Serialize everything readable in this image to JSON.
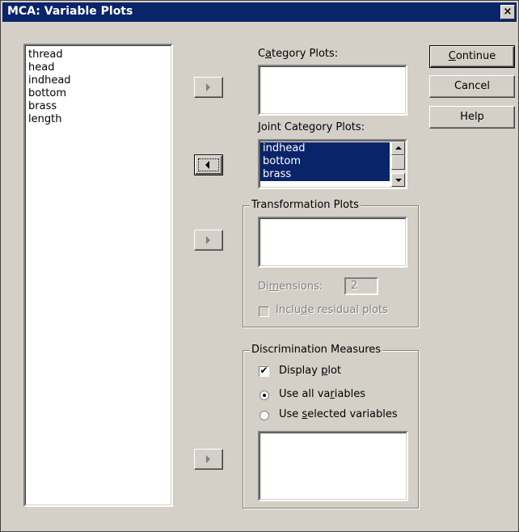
{
  "window": {
    "title": "MCA: Variable Plots",
    "close_glyph": "×"
  },
  "source_list": {
    "items": [
      "thread",
      "head",
      "indhead",
      "bottom",
      "brass",
      "length"
    ]
  },
  "category_plots": {
    "label_pre": "C",
    "label_u": "a",
    "label_post": "tegory Plots:",
    "items": []
  },
  "joint_category_plots": {
    "label_pre": "",
    "label_u": "J",
    "label_post": "oint Category Plots:",
    "items": [
      "indhead",
      "bottom",
      "brass"
    ]
  },
  "transformation_plots": {
    "legend": "Transformation Plots",
    "dimensions_pre": "Di",
    "dimensions_u": "m",
    "dimensions_post": "ensions:",
    "dimensions_value": "2",
    "residual_pre": "Inclu",
    "residual_u": "d",
    "residual_post": "e residual plots",
    "residual_checked": false
  },
  "discrimination_measures": {
    "legend": "Discrimination Measures",
    "display_pre": "Display ",
    "display_u": "p",
    "display_post": "lot",
    "display_checked": true,
    "all_pre": "Use all va",
    "all_u": "r",
    "all_post": "iables",
    "selected_pre": "Use ",
    "selected_u": "s",
    "selected_post": "elected variables",
    "selected_option": "all"
  },
  "buttons": {
    "continue_u": "C",
    "continue_post": "ontinue",
    "cancel": "Cancel",
    "help": "Help"
  },
  "colors": {
    "title_bar": "#0a246a",
    "dialog_face": "#d4d0c8",
    "selection": "#0a246a"
  }
}
